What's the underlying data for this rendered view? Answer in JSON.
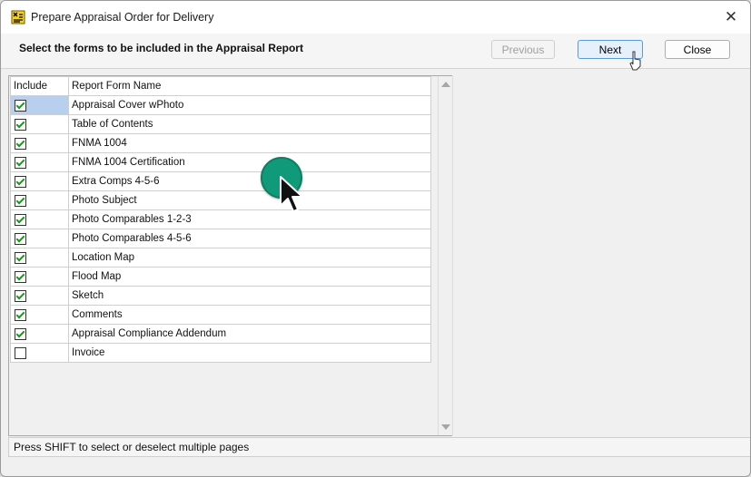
{
  "window": {
    "title": "Prepare Appraisal Order for Delivery",
    "close_glyph": "✕"
  },
  "header": {
    "instruction": "Select the forms to be included in the Appraisal Report",
    "buttons": {
      "previous": "Previous",
      "next": "Next",
      "close": "Close"
    }
  },
  "table": {
    "columns": [
      "Include",
      "Report Form Name"
    ],
    "rows": [
      {
        "include": true,
        "name": "Appraisal Cover wPhoto"
      },
      {
        "include": true,
        "name": "Table of Contents"
      },
      {
        "include": true,
        "name": "FNMA 1004"
      },
      {
        "include": true,
        "name": "FNMA 1004 Certification"
      },
      {
        "include": true,
        "name": "Extra Comps 4-5-6"
      },
      {
        "include": true,
        "name": "Photo Subject"
      },
      {
        "include": true,
        "name": "Photo Comparables 1-2-3"
      },
      {
        "include": true,
        "name": "Photo Comparables 4-5-6"
      },
      {
        "include": true,
        "name": "Location Map"
      },
      {
        "include": true,
        "name": "Flood Map"
      },
      {
        "include": true,
        "name": "Sketch"
      },
      {
        "include": true,
        "name": "Comments"
      },
      {
        "include": true,
        "name": "Appraisal Compliance Addendum"
      },
      {
        "include": false,
        "name": "Invoice"
      }
    ]
  },
  "status": {
    "text": "Press SHIFT to select or deselect multiple pages"
  },
  "icons": {
    "app": "app-form-icon",
    "close": "close-icon"
  },
  "colors": {
    "accent": "#5b9bd5",
    "selected_cell": "#b8cfee",
    "cursor_highlight": "#119a7a",
    "check_mark": "#1a9a1a"
  }
}
